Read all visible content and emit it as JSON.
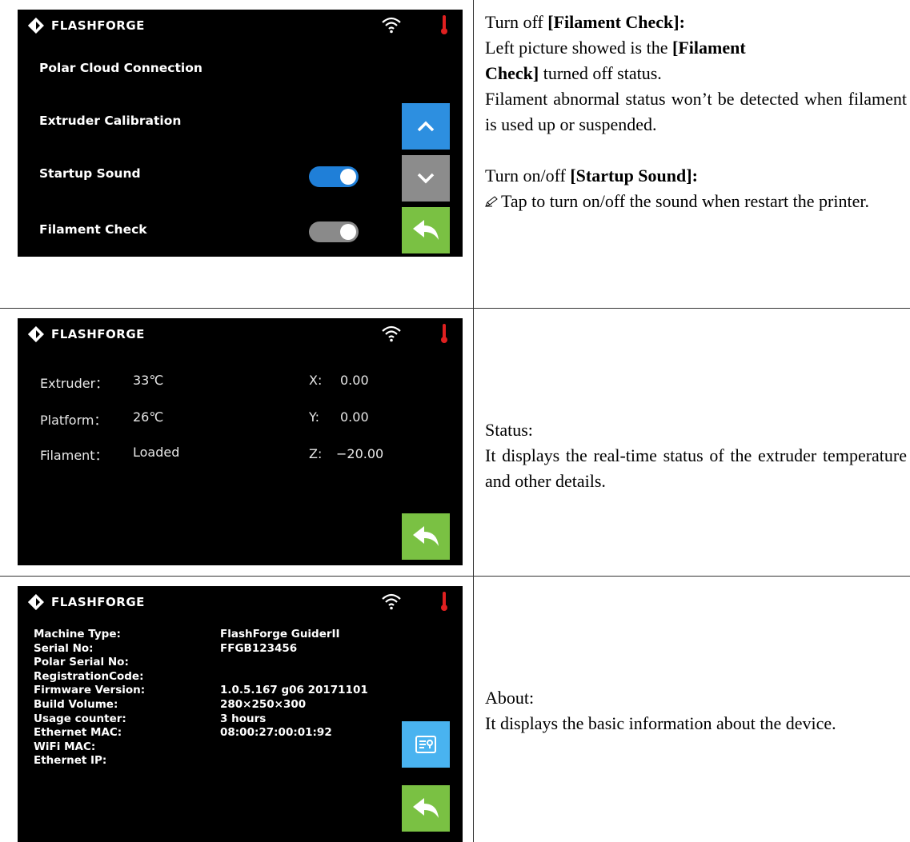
{
  "brand": {
    "name": "FLASHFORGE"
  },
  "icons": {
    "logo": "flashforge-diamond-logo",
    "wifi": "wifi-icon",
    "thermometer": "thermometer-icon",
    "up": "chevron-up-icon",
    "down": "chevron-down-icon",
    "back": "back-arrow-icon",
    "info": "info-card-icon",
    "pencil": "pencil-icon"
  },
  "colors": {
    "blue": "#2d8fe0",
    "gray": "#8c8c8c",
    "green": "#7ac143",
    "thermo": "#e02020"
  },
  "settings_screen": {
    "items": [
      {
        "label": "Polar Cloud Connection"
      },
      {
        "label": "Extruder Calibration"
      },
      {
        "label": "Startup Sound",
        "toggle": "on"
      },
      {
        "label": "Filament Check",
        "toggle": "off"
      }
    ]
  },
  "settings_text": {
    "line1_pre": "Turn off ",
    "line1_bold": "[Filament Check]:",
    "line2_pre": "Left picture showed is the ",
    "line2_bold": "[Filament",
    "line3_bold": "Check]",
    "line3_post": " turned off status.",
    "para2": "Filament abnormal status won’t be detected when filament is used up or suspended.",
    "line5_pre": "Turn on/off ",
    "line5_bold": "[Startup Sound]:",
    "para3": "Tap to turn on/off the sound when restart the printer."
  },
  "status_screen": {
    "rows": [
      {
        "label": "Extruder：",
        "value": "33℃",
        "axis": "X:",
        "axis_value": "0.00"
      },
      {
        "label": "Platform：",
        "value": "26℃",
        "axis": "Y:",
        "axis_value": "0.00"
      },
      {
        "label": "Filament：",
        "value": "Loaded",
        "axis": "Z:",
        "axis_value": "−20.00"
      }
    ]
  },
  "status_text": {
    "title": "Status:",
    "body": "It displays the real-time status of the extruder temperature and other details."
  },
  "about_screen": {
    "rows": [
      {
        "label": "Machine Type:",
        "value": "FlashForge GuiderII"
      },
      {
        "label": "Serial No:",
        "value": "FFGB123456"
      },
      {
        "label": "Polar Serial No:",
        "value": ""
      },
      {
        "label": "RegistrationCode:",
        "value": ""
      },
      {
        "label": "Firmware Version:",
        "value": "1.0.5.167 g06 20171101"
      },
      {
        "label": "Build Volume:",
        "value": "280×250×300"
      },
      {
        "label": "Usage counter:",
        "value": "3 hours"
      },
      {
        "label": "Ethernet MAC:",
        "value": "08:00:27:00:01:92"
      },
      {
        "label": "WiFi MAC:",
        "value": ""
      },
      {
        "label": "Ethernet IP:",
        "value": ""
      }
    ]
  },
  "about_text": {
    "title": "About:",
    "body": "It displays the basic information about the device."
  }
}
